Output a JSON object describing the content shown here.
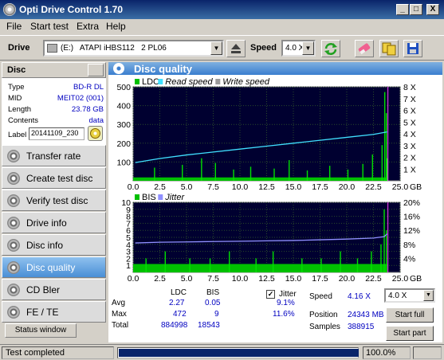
{
  "window": {
    "title": "Opti Drive Control 1.70",
    "min": "_",
    "max": "□",
    "close": "X"
  },
  "menu": [
    "File",
    "Start test",
    "Extra",
    "Help"
  ],
  "toolbar": {
    "drive_label": "Drive",
    "drive_value": "(E:)   ATAPI iHBS112   2 PL06",
    "speed_label": "Speed",
    "speed_value": "4.0 X"
  },
  "disc": {
    "header": "Disc",
    "type_label": "Type",
    "type_value": "BD-R DL",
    "mid_label": "MID",
    "mid_value": "MEIT02 (001)",
    "length_label": "Length",
    "length_value": "23.78 GB",
    "contents_label": "Contents",
    "contents_value": "data",
    "label_label": "Label",
    "label_value": "20141109_230"
  },
  "nav": [
    "Transfer rate",
    "Create test disc",
    "Verify test disc",
    "Drive info",
    "Disc info",
    "Disc quality",
    "CD Bler",
    "FE / TE"
  ],
  "nav_active": 5,
  "status_window": "Status window",
  "panel_title": "Disc quality",
  "chart_data": [
    {
      "type": "bar",
      "legend": [
        "LDC",
        "Read speed",
        "Write speed"
      ],
      "colors": {
        "LDC": "#00c000",
        "Read speed": "#40e0ff",
        "Write speed": "#9a9a9a"
      },
      "x_ticks": [
        "0.0",
        "2.5",
        "5.0",
        "7.5",
        "10.0",
        "12.5",
        "15.0",
        "17.5",
        "20.0",
        "22.5",
        "25.0"
      ],
      "x_unit": "GB",
      "xlim": [
        0,
        25
      ],
      "y_ticks": [
        "100",
        "200",
        "300",
        "400",
        "500"
      ],
      "ylim": [
        0,
        500
      ],
      "y2_ticks": [
        "1 X",
        "2 X",
        "3 X",
        "4 X",
        "5 X",
        "6 X",
        "7 X",
        "8 X"
      ],
      "y2lim": [
        0,
        8
      ],
      "read_speed": {
        "x": [
          0.2,
          2.5,
          5,
          7.5,
          10,
          12.5,
          15,
          17.5,
          20,
          22.5,
          23.78
        ],
        "y": [
          1.55,
          1.9,
          2.2,
          2.45,
          2.7,
          2.95,
          3.2,
          3.45,
          3.7,
          3.95,
          4.16
        ]
      },
      "ldc_baseline": 18,
      "ldc_spikes": [
        [
          2.0,
          70
        ],
        [
          4.6,
          85
        ],
        [
          6.4,
          120
        ],
        [
          7.7,
          95
        ],
        [
          9.4,
          60
        ],
        [
          11.0,
          75
        ],
        [
          13.2,
          65
        ],
        [
          14.6,
          110
        ],
        [
          16.3,
          55
        ],
        [
          18.4,
          80
        ],
        [
          20.1,
          60
        ],
        [
          21.5,
          90
        ],
        [
          22.4,
          140
        ],
        [
          23.3,
          190
        ],
        [
          23.55,
          472
        ],
        [
          23.7,
          360
        ],
        [
          23.78,
          120
        ]
      ]
    },
    {
      "type": "bar",
      "legend": [
        "BIS",
        "Jitter"
      ],
      "colors": {
        "BIS": "#00c000",
        "Jitter": "#9090ff"
      },
      "x_ticks": [
        "0.0",
        "2.5",
        "5.0",
        "7.5",
        "10.0",
        "12.5",
        "15.0",
        "17.5",
        "20.0",
        "22.5",
        "25.0"
      ],
      "x_unit": "GB",
      "xlim": [
        0,
        25
      ],
      "y_ticks": [
        "1",
        "2",
        "3",
        "4",
        "5",
        "6",
        "7",
        "8",
        "9",
        "10"
      ],
      "ylim": [
        0,
        10
      ],
      "y2_ticks": [
        "4%",
        "8%",
        "12%",
        "16%",
        "20%"
      ],
      "y2lim": [
        0,
        20
      ],
      "bis_baseline": 1.2,
      "bis_spikes": [
        [
          1.2,
          2
        ],
        [
          3.0,
          3
        ],
        [
          5.3,
          2
        ],
        [
          7.2,
          2
        ],
        [
          9.0,
          3
        ],
        [
          11.5,
          2
        ],
        [
          13.1,
          3
        ],
        [
          15.8,
          2
        ],
        [
          17.6,
          2
        ],
        [
          19.4,
          3
        ],
        [
          21.0,
          2
        ],
        [
          22.3,
          3
        ],
        [
          23.2,
          4
        ],
        [
          23.5,
          9
        ],
        [
          23.7,
          6
        ]
      ],
      "jitter": {
        "x": [
          0.2,
          2.5,
          5,
          7.5,
          10,
          12.5,
          15,
          17.5,
          20,
          22.5,
          23.5,
          23.78
        ],
        "y": [
          8.4,
          8.6,
          8.7,
          8.8,
          8.9,
          9.0,
          9.1,
          9.3,
          9.5,
          9.8,
          10.2,
          11.0
        ]
      }
    }
  ],
  "stats": {
    "col_ldc": "LDC",
    "col_bis": "BIS",
    "jitter_label": "Jitter",
    "jitter_checked": "✓",
    "avg_label": "Avg",
    "avg_ldc": "2.27",
    "avg_bis": "0.05",
    "avg_jitter": "9.1%",
    "max_label": "Max",
    "max_ldc": "472",
    "max_bis": "9",
    "max_jitter": "11.6%",
    "total_label": "Total",
    "total_ldc": "884998",
    "total_bis": "18543",
    "speed_label": "Speed",
    "speed_value": "4.16 X",
    "speed_combo": "4.0 X",
    "position_label": "Position",
    "position_value": "24343 MB",
    "samples_label": "Samples",
    "samples_value": "388915",
    "start_full": "Start full",
    "start_part": "Start part"
  },
  "statusbar": {
    "text": "Test completed",
    "progress": 1.0,
    "percent": "100.0%"
  }
}
